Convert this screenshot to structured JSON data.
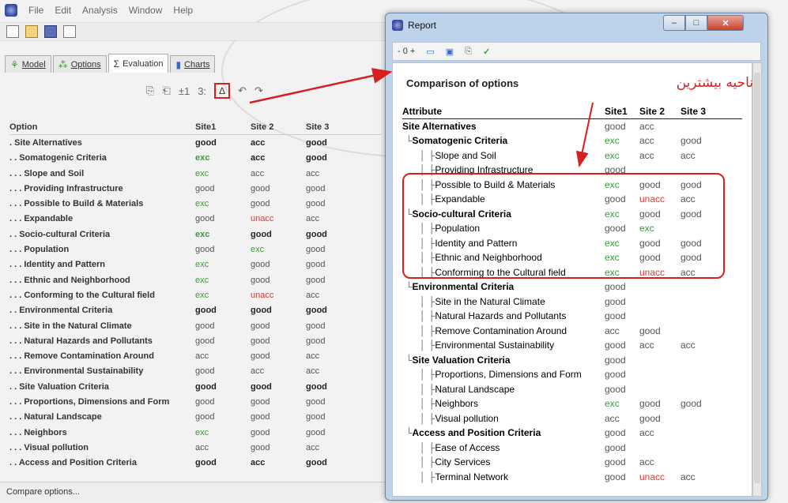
{
  "menu": {
    "items": [
      "File",
      "Edit",
      "Analysis",
      "Window",
      "Help"
    ]
  },
  "tabs": [
    "Model",
    "Options",
    "Evaluation",
    "Charts"
  ],
  "toolbar2": {
    "items": [
      "±1",
      "3:",
      "∆",
      "↶",
      "↷"
    ]
  },
  "grid": {
    "columns": [
      "Option",
      "Site1",
      "Site 2",
      "Site 3"
    ],
    "rows": [
      [
        ". Site Alternatives",
        "good",
        "acc",
        "good"
      ],
      [
        ". . Somatogenic Criteria",
        "exc",
        "acc",
        "good"
      ],
      [
        ". . . Slope and Soil",
        "exc",
        "acc",
        "acc"
      ],
      [
        ". . . Providing Infrastructure",
        "good",
        "good",
        "good"
      ],
      [
        ". . . Possible to Build & Materials",
        "exc",
        "good",
        "good"
      ],
      [
        ". . . Expandable",
        "good",
        "unacc",
        "acc"
      ],
      [
        ". . Socio-cultural Criteria",
        "exc",
        "good",
        "good"
      ],
      [
        ". . . Population",
        "good",
        "exc",
        "good"
      ],
      [
        ". . . Identity and Pattern",
        "exc",
        "good",
        "good"
      ],
      [
        ". . . Ethnic and Neighborhood",
        "exc",
        "good",
        "good"
      ],
      [
        ". . . Conforming to the Cultural field",
        "exc",
        "unacc",
        "acc"
      ],
      [
        ". . Environmental Criteria",
        "good",
        "good",
        "good"
      ],
      [
        ". . . Site in the Natural Climate",
        "good",
        "good",
        "good"
      ],
      [
        ". . . Natural Hazards and Pollutants",
        "good",
        "good",
        "good"
      ],
      [
        ". . . Remove Contamination Around",
        "acc",
        "good",
        "acc"
      ],
      [
        ". . . Environmental Sustainability",
        "good",
        "acc",
        "acc"
      ],
      [
        ". . Site Valuation Criteria",
        "good",
        "good",
        "good"
      ],
      [
        ". . . Proportions, Dimensions and Form",
        "good",
        "good",
        "good"
      ],
      [
        ". . . Natural Landscape",
        "good",
        "good",
        "good"
      ],
      [
        ". . . Neighbors",
        "exc",
        "good",
        "good"
      ],
      [
        ". . . Visual pollution",
        "acc",
        "good",
        "acc"
      ],
      [
        ". . Access and Position Criteria",
        "good",
        "acc",
        "good"
      ]
    ]
  },
  "status": "Compare options...",
  "report": {
    "title": "Report",
    "toolbar": [
      "- 0 +",
      "print",
      "save",
      "copy",
      "✓"
    ],
    "heading": "Comparison of options",
    "annotation": "ناحیه بیشترین",
    "columns": [
      "Attribute",
      "Site1",
      "Site 2",
      "Site 3"
    ],
    "rows": [
      {
        "level": 0,
        "label": "Site Alternatives",
        "v": [
          "good",
          "acc",
          ""
        ]
      },
      {
        "level": 1,
        "label": "Somatogenic Criteria",
        "v": [
          "exc",
          "acc",
          "good"
        ]
      },
      {
        "level": 2,
        "label": "Slope and Soil",
        "v": [
          "exc",
          "acc",
          "acc"
        ]
      },
      {
        "level": 2,
        "label": "Providing Infrastructure",
        "v": [
          "good",
          "",
          ""
        ]
      },
      {
        "level": 2,
        "label": "Possible to Build & Materials",
        "v": [
          "exc",
          "good",
          "good"
        ]
      },
      {
        "level": 2,
        "label": "Expandable",
        "v": [
          "good",
          "unacc",
          "acc"
        ]
      },
      {
        "level": 1,
        "label": "Socio-cultural Criteria",
        "v": [
          "exc",
          "good",
          "good"
        ]
      },
      {
        "level": 2,
        "label": "Population",
        "v": [
          "good",
          "exc",
          ""
        ]
      },
      {
        "level": 2,
        "label": "Identity and Pattern",
        "v": [
          "exc",
          "good",
          "good"
        ]
      },
      {
        "level": 2,
        "label": "Ethnic and Neighborhood",
        "v": [
          "exc",
          "good",
          "good"
        ]
      },
      {
        "level": 2,
        "label": "Conforming to the Cultural field",
        "v": [
          "exc",
          "unacc",
          "acc"
        ]
      },
      {
        "level": 1,
        "label": "Environmental Criteria",
        "v": [
          "good",
          "",
          ""
        ]
      },
      {
        "level": 2,
        "label": "Site in the Natural Climate",
        "v": [
          "good",
          "",
          ""
        ]
      },
      {
        "level": 2,
        "label": "Natural Hazards and Pollutants",
        "v": [
          "good",
          "",
          ""
        ]
      },
      {
        "level": 2,
        "label": "Remove Contamination Around",
        "v": [
          "acc",
          "good",
          ""
        ]
      },
      {
        "level": 2,
        "label": "Environmental Sustainability",
        "v": [
          "good",
          "acc",
          "acc"
        ]
      },
      {
        "level": 1,
        "label": "Site Valuation Criteria",
        "v": [
          "good",
          "",
          ""
        ]
      },
      {
        "level": 2,
        "label": "Proportions, Dimensions and Form",
        "v": [
          "good",
          "",
          ""
        ]
      },
      {
        "level": 2,
        "label": "Natural Landscape",
        "v": [
          "good",
          "",
          ""
        ]
      },
      {
        "level": 2,
        "label": "Neighbors",
        "v": [
          "exc",
          "good",
          "good"
        ]
      },
      {
        "level": 2,
        "label": "Visual pollution",
        "v": [
          "acc",
          "good",
          ""
        ]
      },
      {
        "level": 1,
        "label": "Access and Position Criteria",
        "v": [
          "good",
          "acc",
          ""
        ]
      },
      {
        "level": 2,
        "label": "Ease of Access",
        "v": [
          "good",
          "",
          ""
        ]
      },
      {
        "level": 2,
        "label": "City Services",
        "v": [
          "good",
          "acc",
          ""
        ]
      },
      {
        "level": 2,
        "label": "Terminal Network",
        "v": [
          "good",
          "unacc",
          "acc"
        ]
      }
    ]
  },
  "colors": {
    "exc": "#3a9a3a",
    "unacc": "#d23b3b",
    "annotation": "#d71f1f"
  }
}
